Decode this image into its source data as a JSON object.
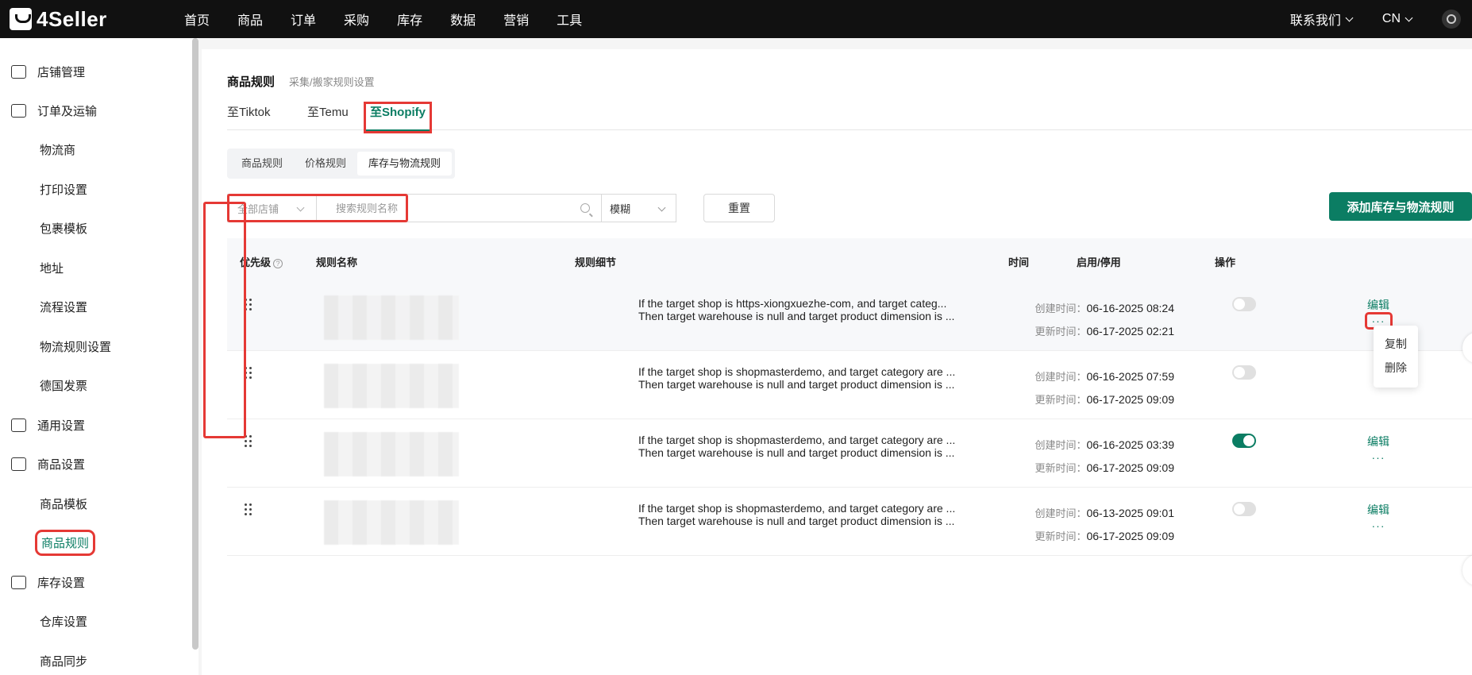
{
  "brand": {
    "name": "4Seller"
  },
  "topnav": [
    "首页",
    "商品",
    "订单",
    "采购",
    "库存",
    "数据",
    "营销",
    "工具"
  ],
  "top_right": {
    "contact": "联系我们",
    "lang": "CN"
  },
  "sidebar": {
    "items": [
      {
        "label": "店铺管理",
        "type": "section"
      },
      {
        "label": "订单及运输",
        "type": "section"
      },
      {
        "label": "物流商",
        "type": "sub"
      },
      {
        "label": "打印设置",
        "type": "sub"
      },
      {
        "label": "包裹模板",
        "type": "sub"
      },
      {
        "label": "地址",
        "type": "sub"
      },
      {
        "label": "流程设置",
        "type": "sub"
      },
      {
        "label": "物流规则设置",
        "type": "sub"
      },
      {
        "label": "德国发票",
        "type": "sub"
      },
      {
        "label": "通用设置",
        "type": "section"
      },
      {
        "label": "商品设置",
        "type": "section"
      },
      {
        "label": "商品模板",
        "type": "sub"
      },
      {
        "label": "商品规则",
        "type": "sub",
        "active": true
      },
      {
        "label": "库存设置",
        "type": "section"
      },
      {
        "label": "仓库设置",
        "type": "sub"
      },
      {
        "label": "商品同步",
        "type": "sub"
      }
    ]
  },
  "page": {
    "title": "商品规则",
    "subtitle": "采集/搬家规则设置",
    "tabs": [
      "至Tiktok",
      "至Temu",
      "至Shopify"
    ],
    "active_tab": "至Shopify",
    "segments": [
      "商品规则",
      "价格规则",
      "库存与物流规则"
    ],
    "active_segment": "库存与物流规则"
  },
  "filter": {
    "shop_select": "全部店铺",
    "search_placeholder": "搜索规则名称",
    "mode_select": "模糊",
    "reset_label": "重置",
    "add_label": "添加库存与物流规则"
  },
  "table": {
    "headers": {
      "priority": "优先级",
      "name": "规则名称",
      "detail": "规则细节",
      "time": "时间",
      "toggle": "启用/停用",
      "ops": "操作"
    },
    "created_label": "创建时间：",
    "updated_label": "更新时间：",
    "edit_label": "编辑",
    "more_label": "···",
    "rows": [
      {
        "detail1": "If the target shop is https-xiongxuezhe-com, and target categ...",
        "detail2": "Then target warehouse is null and target product dimension is ...",
        "created": "06-16-2025 08:24",
        "updated": "06-17-2025 02:21",
        "enabled": false
      },
      {
        "detail1": "If the target shop is shopmasterdemo, and target category are ...",
        "detail2": "Then target warehouse is null and target product dimension is ...",
        "created": "06-16-2025 07:59",
        "updated": "06-17-2025 09:09",
        "enabled": false
      },
      {
        "detail1": "If the target shop is shopmasterdemo, and target category are ...",
        "detail2": "Then target warehouse is null and target product dimension is ...",
        "created": "06-16-2025 03:39",
        "updated": "06-17-2025 09:09",
        "enabled": true
      },
      {
        "detail1": "If the target shop is shopmasterdemo, and target category are ...",
        "detail2": "Then target warehouse is null and target product dimension is ...",
        "created": "06-13-2025 09:01",
        "updated": "06-17-2025 09:09",
        "enabled": false
      }
    ]
  },
  "dropdown": {
    "copy": "复制",
    "delete": "删除"
  },
  "colors": {
    "accent": "#0b7d63",
    "highlight": "#e53935",
    "topbar": "#111111"
  }
}
